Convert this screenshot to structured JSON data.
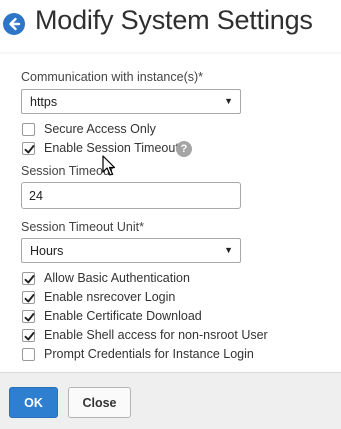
{
  "header": {
    "title": "Modify System Settings",
    "back_icon": "back-arrow-circle-icon"
  },
  "form": {
    "communication": {
      "label": "Communication with instance(s)*",
      "value": "https"
    },
    "secure_access_only": {
      "label": "Secure Access Only",
      "checked": false
    },
    "enable_session_timeout": {
      "label": "Enable Session Timeout",
      "checked": true,
      "help_glyph": "?"
    },
    "session_timeout": {
      "label": "Session Timeout",
      "value": "24"
    },
    "session_timeout_unit": {
      "label": "Session Timeout Unit*",
      "value": "Hours"
    },
    "allow_basic_auth": {
      "label": "Allow Basic Authentication",
      "checked": true
    },
    "enable_nsrecover": {
      "label": "Enable nsrecover Login",
      "checked": true
    },
    "enable_cert_download": {
      "label": "Enable Certificate Download",
      "checked": true
    },
    "enable_shell_access": {
      "label": "Enable Shell access for non-nsroot User",
      "checked": true
    },
    "prompt_credentials": {
      "label": "Prompt Credentials for Instance Login",
      "checked": false
    }
  },
  "footer": {
    "ok_label": "OK",
    "close_label": "Close"
  },
  "colors": {
    "accent": "#2f7fd0",
    "footer_bg": "#efefef"
  }
}
